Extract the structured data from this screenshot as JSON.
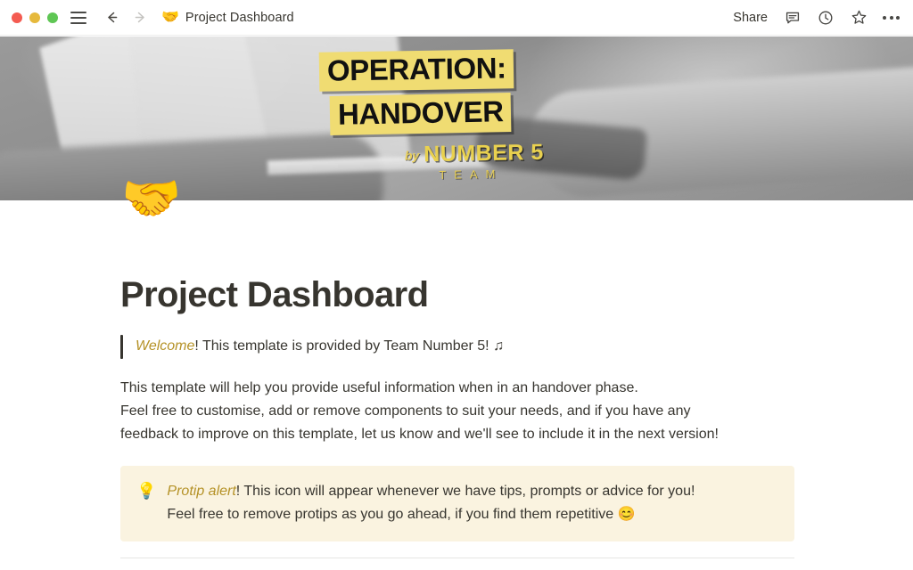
{
  "window": {
    "traffic_lights": [
      {
        "name": "close",
        "color": "#f45b51"
      },
      {
        "name": "minimize",
        "color": "#e6b93c"
      },
      {
        "name": "maximize",
        "color": "#5fc654"
      }
    ],
    "menu_icon": "hamburger-icon",
    "back_label": "Back",
    "forward_label": "Forward",
    "breadcrumb": {
      "emoji": "🤝",
      "title": "Project Dashboard"
    },
    "actions": {
      "share_label": "Share",
      "comment_icon": "comment-icon",
      "history_icon": "clock-icon",
      "favorite_icon": "star-icon",
      "more_icon": "more-options-icon"
    }
  },
  "cover": {
    "alt": "grayscale photo of hands passing sheets of paper",
    "logo": {
      "line1": "OPERATION:",
      "line2": "HANDOVER",
      "by": "by",
      "brand": "NUMBER 5",
      "team": "TEAM",
      "highlight_color": "#f0dc72",
      "brand_color": "#e9d14f"
    }
  },
  "page": {
    "icon": "🤝",
    "title": "Project Dashboard",
    "quote": {
      "accent": "Welcome",
      "rest": "! This template is provided by Team Number 5! ♫"
    },
    "paragraph": [
      "This template will help you provide useful information when in an handover phase.",
      "Feel free to customise, add or remove components to suit your needs, and if you have any",
      "feedback to improve on this template, let us know and we'll see to include it in the next version!"
    ],
    "callout": {
      "icon": "💡",
      "accent": "Protip alert",
      "line1_rest": "! This icon will appear whenever we have tips, prompts or advice for you!",
      "line2": "Feel free to remove protips as you go ahead, if you find them repetitive 😊",
      "background_color": "#faf3e0",
      "accent_color": "#b59227"
    }
  }
}
